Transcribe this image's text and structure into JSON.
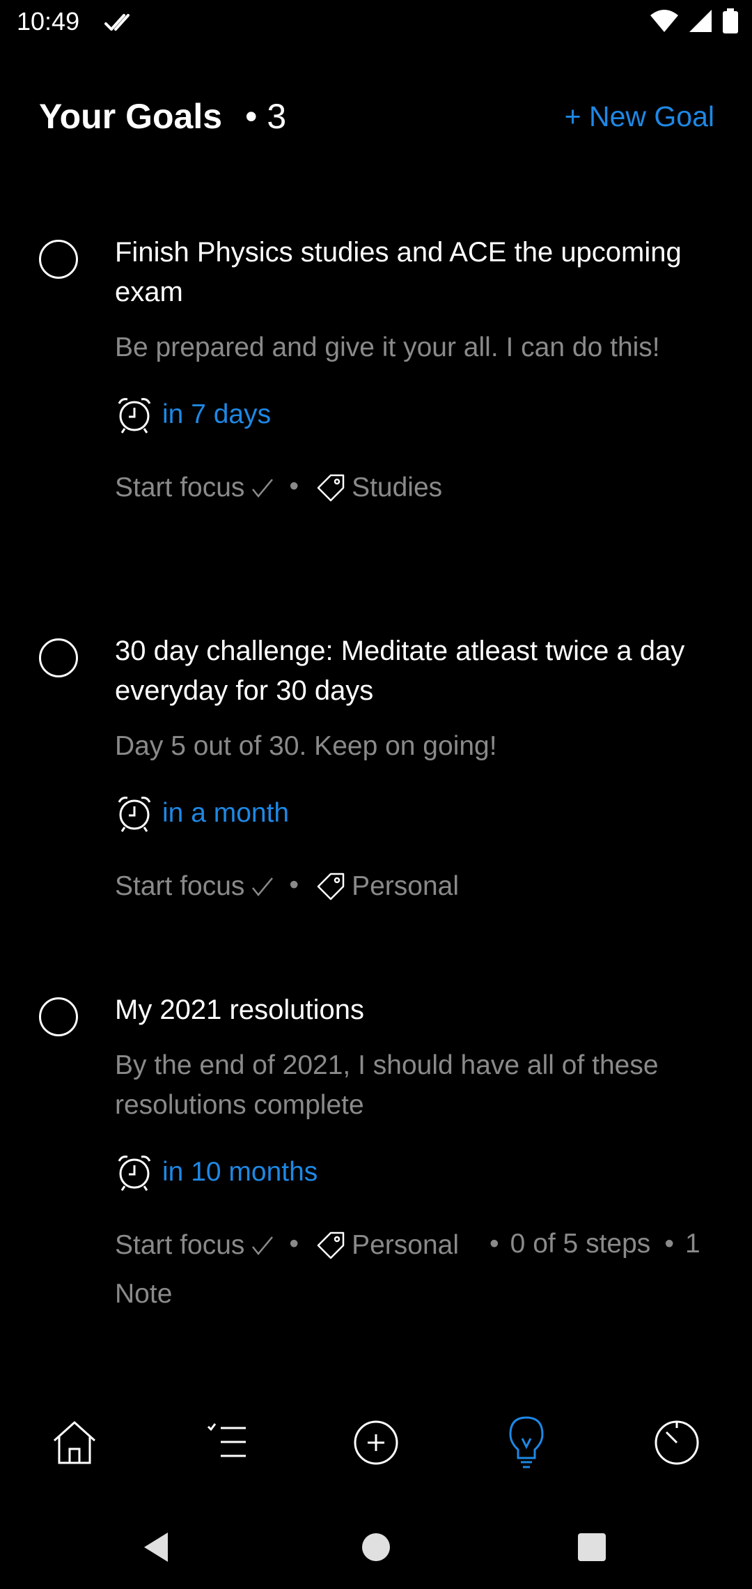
{
  "status_bar": {
    "time": "10:49"
  },
  "header": {
    "title": "Your Goals",
    "count": "• 3",
    "new_goal_label": "+ New Goal"
  },
  "goals": [
    {
      "title": "Finish Physics studies and ACE the upcoming exam",
      "description": "Be prepared and give it your all. I can do this!",
      "due": "in 7 days",
      "focus_label": "Start focus",
      "tag": "Studies"
    },
    {
      "title": "30 day challenge: Meditate atleast twice a day everyday for 30 days",
      "description": "Day 5 out of 30. Keep on going!",
      "due": "in a month",
      "focus_label": "Start focus",
      "tag": "Personal"
    },
    {
      "title": "My 2021 resolutions",
      "description": "By the end of 2021, I should have all of these resolutions complete",
      "due": "in 10 months",
      "focus_label": "Start focus",
      "tag": "Personal",
      "steps": "0 of 5 steps",
      "notes": "1 Note"
    }
  ],
  "bottom_nav": {
    "items": [
      "home-icon",
      "task-list-icon",
      "add-circle-icon",
      "lightbulb-icon",
      "timer-icon"
    ],
    "active_index": 3
  },
  "colors": {
    "background": "#000000",
    "accent": "#1e88e5",
    "secondary_text": "#8a8a8a",
    "primary_text": "#ffffff"
  }
}
